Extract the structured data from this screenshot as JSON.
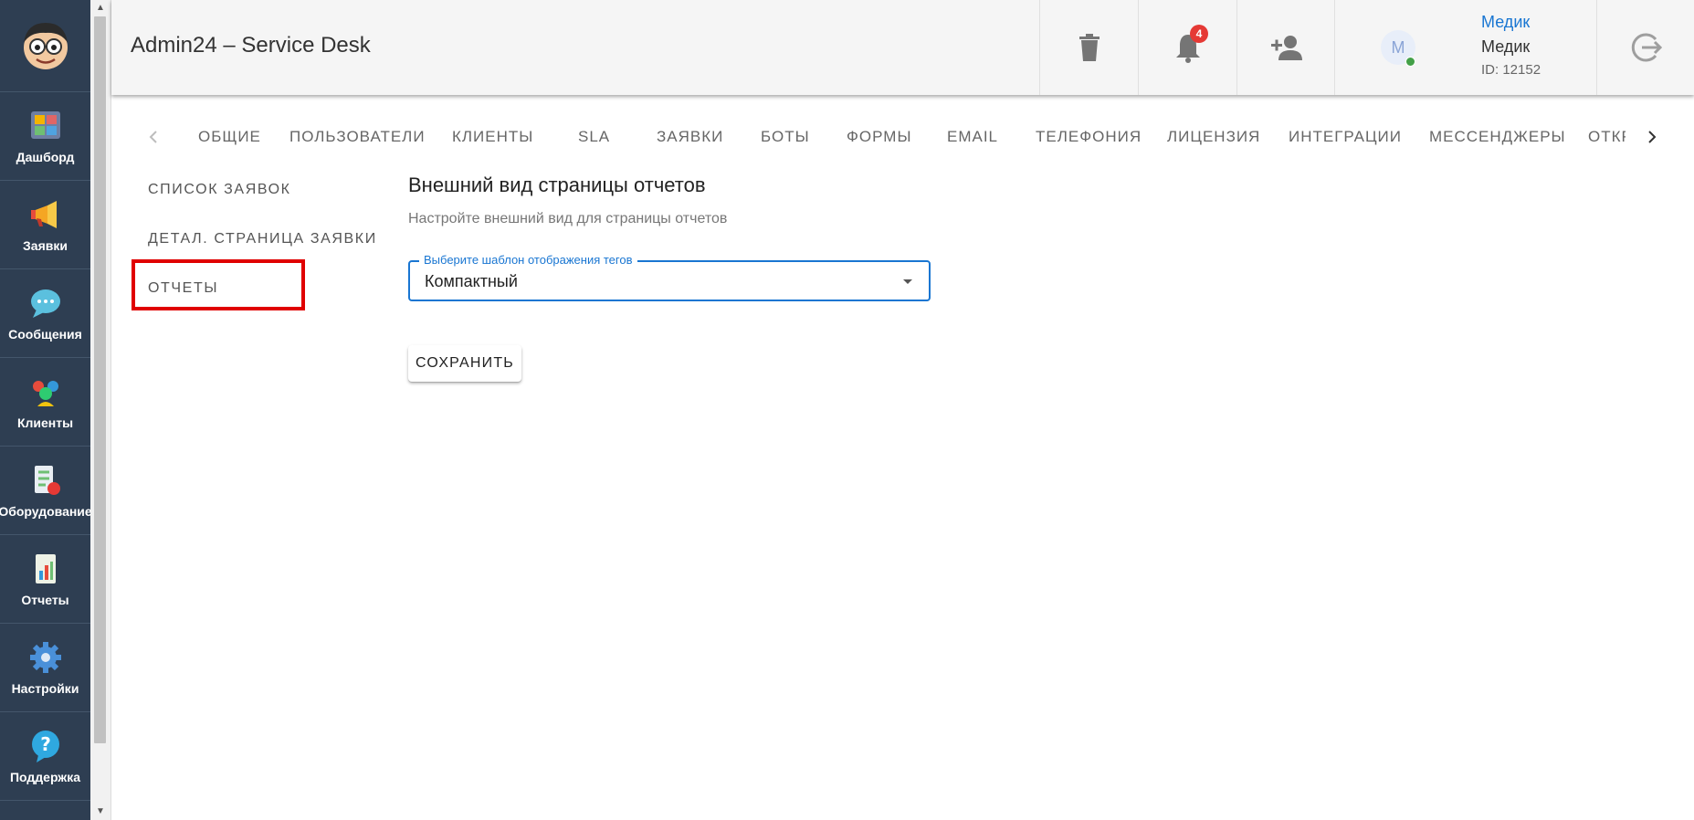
{
  "sidebar": {
    "items": [
      {
        "label": "Дашборд",
        "icon": "dashboard-icon"
      },
      {
        "label": "Заявки",
        "icon": "megaphone-icon"
      },
      {
        "label": "Сообщения",
        "icon": "chat-bubble-icon"
      },
      {
        "label": "Клиенты",
        "icon": "clients-icon"
      },
      {
        "label": "Оборудование",
        "icon": "equipment-icon"
      },
      {
        "label": "Отчеты",
        "icon": "report-icon"
      },
      {
        "label": "Настройки",
        "icon": "gear-icon"
      },
      {
        "label": "Поддержка",
        "icon": "help-icon"
      }
    ]
  },
  "header": {
    "title": "Admin24 – Service Desk",
    "notifications_count": "4",
    "user": {
      "avatar_initial": "М",
      "link": "Медик",
      "name": "Медик",
      "id": "ID: 12152"
    }
  },
  "tabs": [
    "Общие",
    "Пользователи",
    "Клиенты",
    "SLA",
    "Заявки",
    "Боты",
    "Формы",
    "Email",
    "Телефония",
    "Лицензия",
    "Интеграции",
    "Мессенджеры",
    "Откр"
  ],
  "subnav": [
    "Список заявок",
    "Детал. страница заявки",
    "Отчеты"
  ],
  "main": {
    "title": "Внешний вид страницы отчетов",
    "description": "Настройте внешний вид для страницы отчетов",
    "select_label": "Выберите шаблон отображения тегов",
    "select_value": "Компактный",
    "save_label": "Сохранить"
  },
  "colors": {
    "sidebar_bg": "#2e3e52",
    "accent": "#1976d2",
    "badge": "#e53935",
    "highlight": "#e00000",
    "online": "#43a047"
  }
}
